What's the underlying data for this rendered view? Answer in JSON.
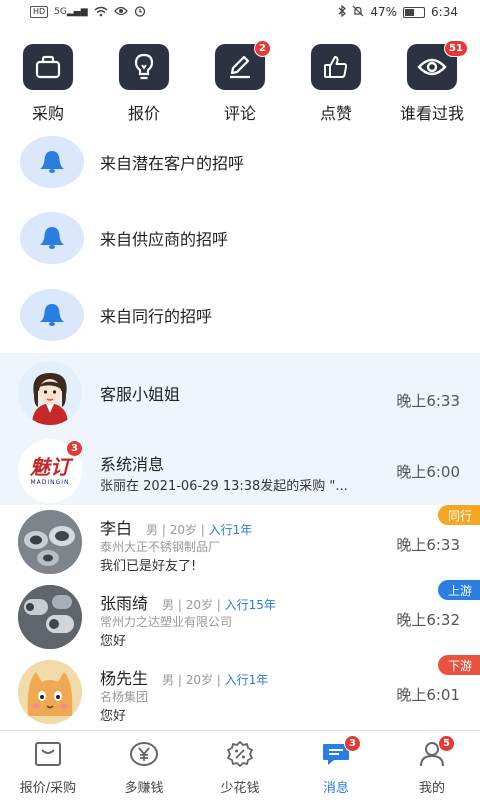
{
  "status_bar": {
    "net_chip": "HD",
    "signal": "5G",
    "battery_text": "47%",
    "battery_level": 0.47,
    "time": "6:34"
  },
  "actions": [
    {
      "label": "采购",
      "icon": "bag-icon",
      "badge": ""
    },
    {
      "label": "报价",
      "icon": "lightbulb-icon",
      "badge": ""
    },
    {
      "label": "评论",
      "icon": "edit-icon",
      "badge": "2"
    },
    {
      "label": "点赞",
      "icon": "thumbs-up-icon",
      "badge": ""
    },
    {
      "label": "谁看过我",
      "icon": "eye-icon",
      "badge": "51"
    }
  ],
  "greetings": [
    {
      "label": "来自潜在客户的招呼"
    },
    {
      "label": "来自供应商的招呼"
    },
    {
      "label": "来自同行的招呼"
    }
  ],
  "system_messages": [
    {
      "name": "客服小姐姐",
      "time": "晚上6:33"
    },
    {
      "name": "系统消息",
      "preview": "张丽在 2021-06-29 13:38发起的采购 \"...",
      "time": "晚上6:00",
      "badge": "3",
      "logo_text": "魅订",
      "logo_sub": "MADINGIN"
    }
  ],
  "chats": [
    {
      "name": "李白",
      "gender": "男",
      "age": "20岁",
      "tenure": "入行1年",
      "company": "泰州大正不锈钢制品厂",
      "preview": "我们已是好友了!",
      "time": "晚上6:33",
      "tag": "同行",
      "tag_color": "#f5a623"
    },
    {
      "name": "张雨绮",
      "gender": "男",
      "age": "20岁",
      "tenure": "入行15年",
      "company": "常州力之达塑业有限公司",
      "preview": "您好",
      "time": "晚上6:32",
      "tag": "上游",
      "tag_color": "#2a7de1"
    },
    {
      "name": "杨先生",
      "gender": "男",
      "age": "20岁",
      "tenure": "入行1年",
      "company": "名杨集团",
      "preview": "您好",
      "time": "晚上6:01",
      "tag": "下游",
      "tag_color": "#e8533f"
    }
  ],
  "tabs": [
    {
      "label": "报价/采购",
      "icon": "inbox-icon",
      "badge": ""
    },
    {
      "label": "多赚钱",
      "icon": "yen-coin-icon",
      "badge": ""
    },
    {
      "label": "少花钱",
      "icon": "discount-icon",
      "badge": ""
    },
    {
      "label": "消息",
      "icon": "message-icon",
      "badge": "3"
    },
    {
      "label": "我的",
      "icon": "user-icon",
      "badge": "5"
    }
  ],
  "colors": {
    "accent": "#2a7de1",
    "dark_icon_bg": "#2d3243",
    "badge": "#e53935",
    "highlight_bg": "#eef5fd"
  }
}
